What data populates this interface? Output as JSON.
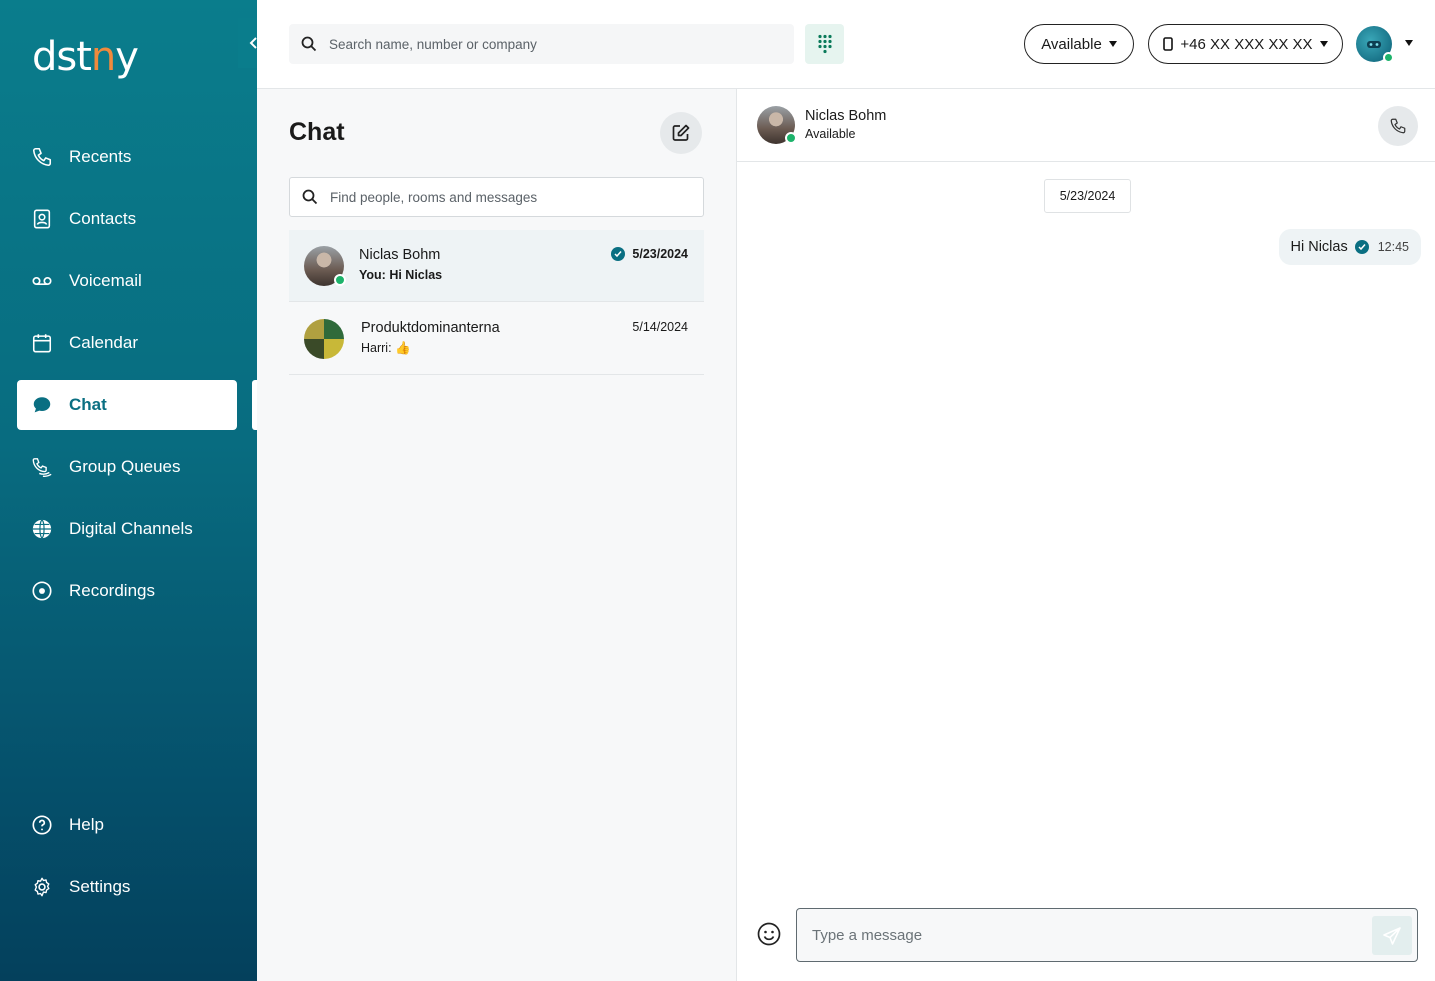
{
  "brand": {
    "logo_text_before": "dst",
    "logo_text_dot": "n",
    "logo_text_after": "y"
  },
  "colors": {
    "accent": "#0a6f82",
    "online": "#1db36b",
    "logo_dot": "#f08a3c"
  },
  "sidebar": {
    "items": [
      {
        "label": "Recents",
        "icon": "phone-icon"
      },
      {
        "label": "Contacts",
        "icon": "contact-card-icon"
      },
      {
        "label": "Voicemail",
        "icon": "voicemail-icon"
      },
      {
        "label": "Calendar",
        "icon": "calendar-icon"
      },
      {
        "label": "Chat",
        "icon": "chat-bubble-icon",
        "active": true
      },
      {
        "label": "Group Queues",
        "icon": "group-queue-icon"
      },
      {
        "label": "Digital Channels",
        "icon": "globe-icon"
      },
      {
        "label": "Recordings",
        "icon": "record-icon"
      }
    ],
    "bottom_items": [
      {
        "label": "Help",
        "icon": "help-icon"
      },
      {
        "label": "Settings",
        "icon": "gear-icon"
      }
    ]
  },
  "topbar": {
    "search_placeholder": "Search name, number or company",
    "status_label": "Available",
    "phone_label": "+46 XX XXX XX XX"
  },
  "chat_list": {
    "title": "Chat",
    "search_placeholder": "Find people, rooms and messages",
    "conversations": [
      {
        "name": "Niclas Bohm",
        "preview": "You: Hi Niclas",
        "date": "5/23/2024",
        "read": true,
        "online": true
      },
      {
        "name": "Produktdominanterna",
        "preview": "Harri: 👍",
        "date": "5/14/2024"
      }
    ]
  },
  "conversation": {
    "contact_name": "Niclas Bohm",
    "contact_status": "Available",
    "date_separator": "5/23/2024",
    "messages": [
      {
        "text": "Hi Niclas",
        "time": "12:45",
        "outgoing": true,
        "read": true
      }
    ],
    "composer_placeholder": "Type a message"
  }
}
